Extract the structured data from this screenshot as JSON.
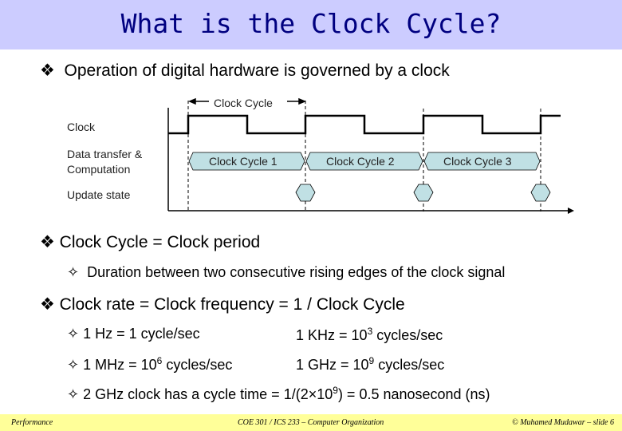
{
  "title": "What is the Clock Cycle?",
  "bullet1": "Operation of digital hardware is governed by a clock",
  "diagram": {
    "clock_cycle_label": "Clock Cycle",
    "row_clock": "Clock",
    "row_data_1": "Data transfer &",
    "row_data_2": "Computation",
    "row_update": "Update state",
    "cycles": [
      "Clock Cycle 1",
      "Clock Cycle 2",
      "Clock Cycle 3"
    ],
    "fill_color": "#c0e0e4"
  },
  "bullet2": "Clock Cycle = Clock period",
  "bullet2_sub": "Duration between two consecutive rising edges of the clock signal",
  "bullet3": "Clock rate = Clock frequency = 1 / Clock Cycle",
  "rates": {
    "hz": "1 Hz = 1 cycle/sec",
    "khz_pre": "1 KHz = 10",
    "khz_exp": "3",
    "khz_post": " cycles/sec",
    "mhz_pre": "1 MHz = 10",
    "mhz_exp": "6",
    "mhz_post": " cycles/sec",
    "ghz_pre": "1 GHz = 10",
    "ghz_exp": "9",
    "ghz_post": " cycles/sec",
    "ex_pre": "2 GHz clock has a cycle time = 1/(2×10",
    "ex_exp": "9",
    "ex_post": ") = 0.5 nanosecond (ns)"
  },
  "footer": {
    "left": "Performance",
    "center": "COE 301 / ICS 233 – Computer Organization",
    "right": "© Muhamed Mudawar – slide 6"
  }
}
